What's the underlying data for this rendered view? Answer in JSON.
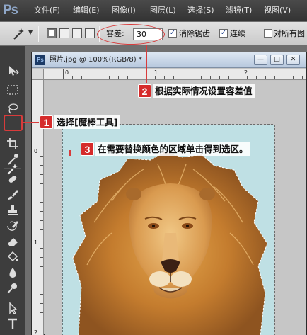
{
  "menubar": {
    "logo": "Ps",
    "items": [
      "文件(F)",
      "编辑(E)",
      "图像(I)",
      "图层(L)",
      "选择(S)",
      "滤镜(T)",
      "视图(V)"
    ]
  },
  "options": {
    "tolerance_label": "容差:",
    "tolerance_value": "30",
    "antialias_label": "消除锯齿",
    "antialias_checked": "✓",
    "contiguous_label": "连续",
    "contiguous_checked": "✓",
    "sample_all_label": "对所有图"
  },
  "document": {
    "title": "照片.jpg @ 100%(RGB/8) *",
    "ps_icon": "Ps",
    "btn_minimize": "—",
    "btn_restore": "□",
    "btn_close": "✕",
    "ruler_h_labels": [
      "0",
      "1",
      "2"
    ],
    "ruler_v_labels": [
      "0",
      "1",
      "2"
    ]
  },
  "annotations": {
    "step1_num": "1",
    "step1_text": "选择[魔棒工具]",
    "step2_num": "2",
    "step2_text": "根据实际情况设置容差值",
    "step3_num": "3",
    "step3_text": "在需要替换颜色的区域单击得到选区。"
  },
  "colors": {
    "accent_red": "#d52b2b",
    "canvas_bg": "#c6c6c6",
    "photo_bg": "#bfe0e4"
  }
}
